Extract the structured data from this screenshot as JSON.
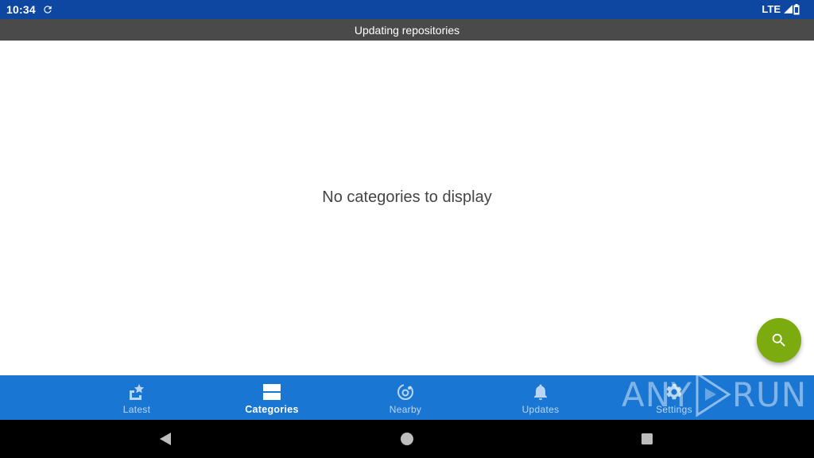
{
  "status_bar": {
    "time": "10:34",
    "network": "LTE",
    "icons": [
      "sync-icon",
      "signal-icon",
      "battery-icon"
    ]
  },
  "banner": {
    "text": "Updating repositories"
  },
  "main": {
    "empty_message": "No categories to display"
  },
  "fab": {
    "icon": "search-icon",
    "color": "#7cab0f"
  },
  "bottom_nav": {
    "color": "#1976d2",
    "active": "Categories",
    "items": [
      {
        "label": "Latest",
        "icon": "star-icon"
      },
      {
        "label": "Categories",
        "icon": "categories-icon"
      },
      {
        "label": "Nearby",
        "icon": "nearby-icon"
      },
      {
        "label": "Updates",
        "icon": "bell-icon"
      },
      {
        "label": "Settings",
        "icon": "gear-icon"
      }
    ]
  },
  "watermark": {
    "text_left": "ANY",
    "text_right": "RUN"
  },
  "system_nav": {
    "buttons": [
      "back-icon",
      "home-icon",
      "recents-icon"
    ]
  }
}
